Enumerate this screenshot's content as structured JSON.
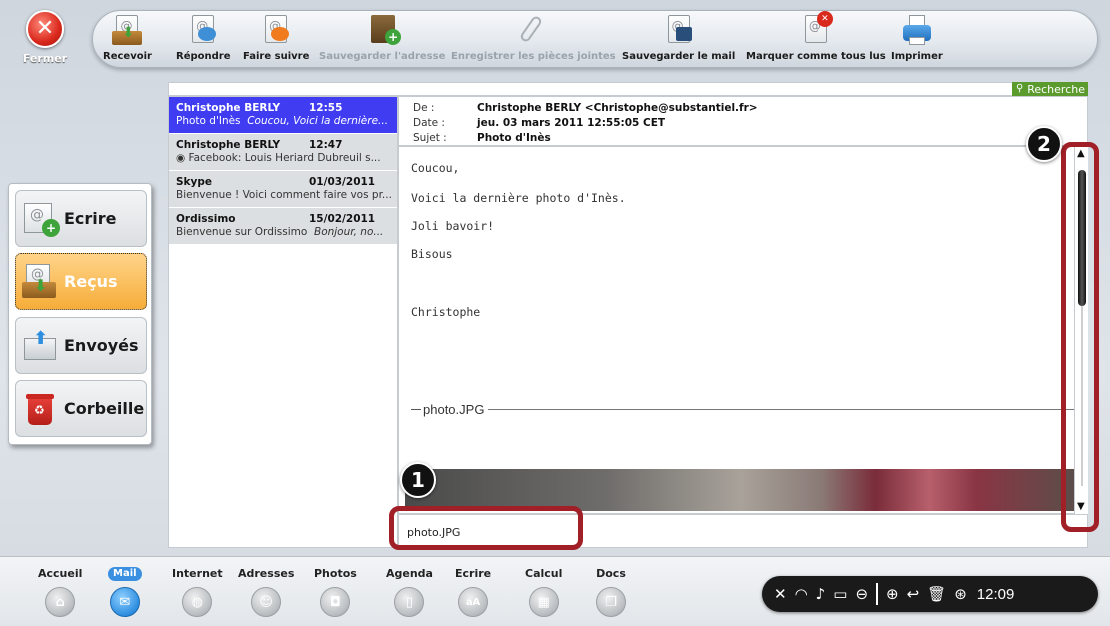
{
  "close": {
    "label": "Fermer"
  },
  "toolbar": {
    "items": [
      {
        "label": "Recevoir",
        "icon": "inbox-receive-icon"
      },
      {
        "label": "Répondre",
        "icon": "reply-icon"
      },
      {
        "label": "Faire suivre",
        "icon": "forward-icon"
      },
      {
        "label": "Sauvegarder l'adresse",
        "icon": "save-address-icon"
      },
      {
        "label": "Enregistrer les pièces jointes",
        "icon": "paperclip-icon"
      },
      {
        "label": "Sauvegarder le mail",
        "icon": "save-mail-icon"
      },
      {
        "label": "Marquer comme tous lus",
        "icon": "mark-read-icon"
      },
      {
        "label": "Imprimer",
        "icon": "printer-icon"
      }
    ]
  },
  "search": {
    "button_label": "Recherche",
    "placeholder": ""
  },
  "nav": {
    "items": [
      {
        "label": "Ecrire",
        "icon": "compose-icon"
      },
      {
        "label": "Reçus",
        "icon": "inbox-icon"
      },
      {
        "label": "Envoyés",
        "icon": "sent-icon"
      },
      {
        "label": "Corbeille",
        "icon": "trash-icon"
      }
    ]
  },
  "messages": [
    {
      "sender": "Christophe BERLY",
      "date": "12:55",
      "subject": "Photo d'Inès",
      "preview": "Coucou, Voici la dernière..."
    },
    {
      "sender": "Christophe BERLY",
      "date": "12:47",
      "subject": "◉ Facebook: Louis Heriard Dubreuil s...",
      "preview": ""
    },
    {
      "sender": "Skype",
      "date": "01/03/2011",
      "subject": "Bienvenue ! Voici comment faire vos pr...",
      "preview": ""
    },
    {
      "sender": "Ordissimo",
      "date": "15/02/2011",
      "subject": "Bienvenue sur Ordissimo",
      "preview": "Bonjour, no..."
    }
  ],
  "header": {
    "from_key": "De :",
    "from_val": "Christophe BERLY <Christophe@substantiel.fr>",
    "date_key": "Date :",
    "date_val": "jeu. 03 mars 2011 12:55:05 CET",
    "subject_key": "Sujet :",
    "subject_val": "Photo d'Inès"
  },
  "body": {
    "line1": "Coucou,",
    "line2": "Voici la dernière photo d'Inès.",
    "line3": "Joli bavoir!",
    "line4": "Bisous",
    "line5": "Christophe",
    "attachment_sep": "photo.JPG"
  },
  "attachment_field": "photo.JPG",
  "callouts": {
    "one": "1",
    "two": "2"
  },
  "dock": {
    "items": [
      {
        "label": "Accueil",
        "icon": "home-icon"
      },
      {
        "label": "Mail",
        "icon": "mail-icon"
      },
      {
        "label": "Internet",
        "icon": "globe-icon"
      },
      {
        "label": "Adresses",
        "icon": "contacts-icon"
      },
      {
        "label": "Photos",
        "icon": "camera-icon"
      },
      {
        "label": "Agenda",
        "icon": "calendar-icon"
      },
      {
        "label": "Ecrire",
        "icon": "text-icon"
      },
      {
        "label": "Calcul",
        "icon": "calculator-icon"
      },
      {
        "label": "Docs",
        "icon": "documents-icon"
      }
    ]
  },
  "tray": {
    "clock": "12:09"
  },
  "colors": {
    "accent": "#3f3cf2",
    "active_nav": "#f6ad39",
    "callout": "#a11f26",
    "search": "#5b9a2c"
  }
}
